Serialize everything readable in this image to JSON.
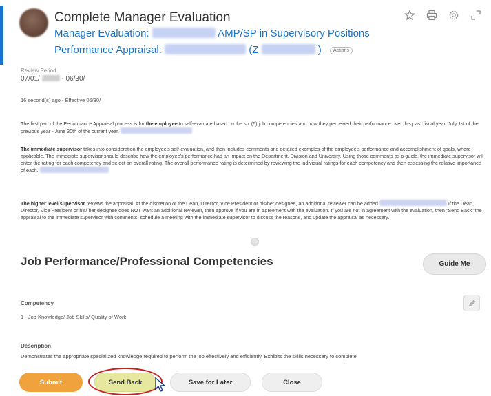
{
  "header": {
    "title": "Complete Manager Evaluation",
    "line1_prefix": "Manager Evaluation:",
    "line1_suffix": "AMP/SP in Supervisory Positions",
    "line2_prefix": "Performance Appraisal:",
    "line2_mid": "(Z",
    "line2_end": ")",
    "actions_badge": "Actions"
  },
  "icons": {
    "star": "star-icon",
    "print": "print-icon",
    "settings": "gear-icon",
    "expand": "expand-icon"
  },
  "review_period": {
    "label": "Review Period",
    "start": "07/01/",
    "separator": "- 06/30/"
  },
  "meta": {
    "ago": "16 second(s) ago",
    "effective": "- Effective 06/30/"
  },
  "paragraphs": {
    "p1_start": "The first part of the Performance Appraisal process is for ",
    "p1_bold": "the employee",
    "p1_rest": " to self-evaluate based on the six (6) job competencies and how they perceived their performance over this past fiscal year, July 1st of the previous year - June 30th of the current year.",
    "p2_bold": "The immediate supervisor",
    "p2_rest": " takes into consideration the employee's self-evaluation, and then includes comments and detailed examples of the employee's performance and accomplishment of goals, where applicable. The immediate supervisor should describe how the employee's performance had an impact on the Department, Division and University. Using those comments as a guide, the immediate supervisor will enter the rating for each competency and select an overall rating. The overall performance rating is determined by reviewing the individual ratings for each competency and then assessing the relative importance of each.",
    "p3_bold": "The higher level supervisor",
    "p3_part1": " reviews the appraisal. At the discretion of the Dean, Director, Vice President or his/her designee, an additional reviewer can be added",
    "p3_part2": " If the Dean, Director, Vice President or his/ her designee does NOT want an additional reviewer, then approve if you are in agreement with the evaluation. If you are not in agreement with the evaluation, then \"Send Back\" the appraisal to the immediate supervisor with comments, schedule a meeting with the immediate supervisor to discuss the reasons, and update the appraisal as necessary."
  },
  "section": {
    "title": "Job Performance/Professional Competencies",
    "guide_button": "Guide Me"
  },
  "competency": {
    "label": "Competency",
    "value": "1 - Job Knowledge/ Job Skills/ Quality of Work",
    "description_label": "Description",
    "description_text": "Demonstrates the appropriate specialized knowledge required to perform the job effectively and efficiently.  Exhibits the skills necessary to complete"
  },
  "footer_buttons": {
    "submit": "Submit",
    "send_back": "Send Back",
    "save_for_later": "Save for Later",
    "close": "Close"
  },
  "colors": {
    "link_blue": "#1a73c9",
    "submit_orange": "#f0a23c",
    "highlight_ring": "#c81f1f",
    "send_back_bg": "#e6e8a0"
  }
}
